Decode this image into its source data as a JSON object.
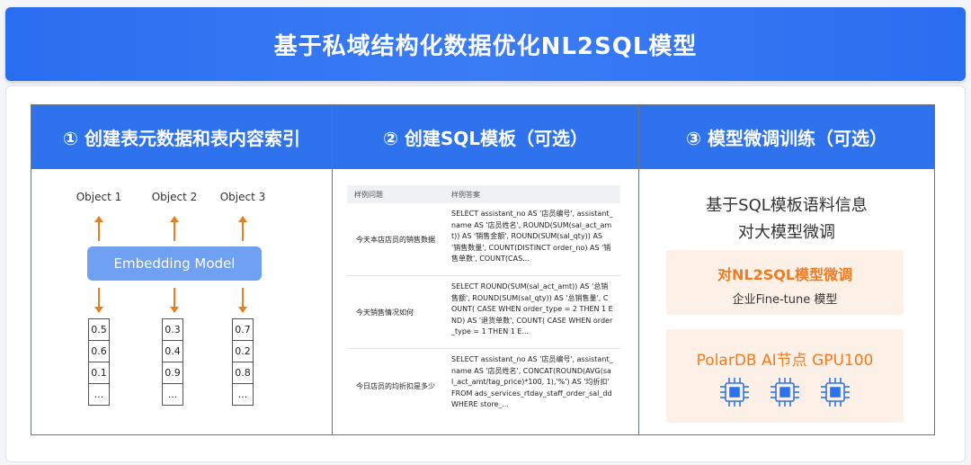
{
  "title": "基于私域结构化数据优化NL2SQL模型",
  "columns": [
    {
      "heading": "① 创建表元数据和表内容索引"
    },
    {
      "heading": "② 创建SQL模板（可选）"
    },
    {
      "heading": "③ 模型微调训练（可选）"
    }
  ],
  "embedding": {
    "objects": [
      "Object 1",
      "Object 2",
      "Object 3"
    ],
    "model_label": "Embedding  Model",
    "vectors": [
      [
        "0.5",
        "0.6",
        "0.1",
        "..."
      ],
      [
        "0.3",
        "0.4",
        "0.9",
        "..."
      ],
      [
        "0.7",
        "0.2",
        "0.8",
        "..."
      ]
    ]
  },
  "sql_table": {
    "header_q": "样例问题",
    "header_a": "样例答案",
    "rows": [
      {
        "q": "今天本店店员的销售数据",
        "a": "SELECT assistant_no AS '店员编号', assistant_name AS '店员姓名', ROUND(SUM(sal_act_amt)) AS '销售金额', ROUND(SUM(sal_qty)) AS '销售数量', COUNT(DISTINCT order_no) AS '销售单数', COUNT(CAS..."
      },
      {
        "q": "今天销售情况如何",
        "a": "SELECT ROUND(SUM(sal_act_amt)) AS '总销售额', ROUND(SUM(sal_qty)) AS '总销售量', COUNT( CASE WHEN order_type = 2 THEN 1 END) AS '退货单数', COUNT( CASE WHEN order_type = 1 THEN 1 E..."
      },
      {
        "q": "今日店员的均折扣是多少",
        "a": "SELECT assistant_no AS '店员编号', assistant_name AS '店员姓名', CONCAT(ROUND(AVG(sal_act_amt/tag_price)*100, 1),'%') AS '均折扣' FROM ads_services_rtday_staff_order_sal_dd WHERE store_..."
      }
    ]
  },
  "finetune": {
    "line1": "基于SQL模板语料信息",
    "line2": "对大模型微调",
    "card1_title": "对NL2SQL模型微调",
    "card1_sub": "企业Fine-tune 模型",
    "card2_title": "PolarDB AI节点 GPU100",
    "chips": [
      "chip-icon",
      "chip-icon",
      "chip-icon"
    ]
  },
  "colors": {
    "title_bg": "#2a6ef0",
    "header_bg": "#2f72ee",
    "embed_bg": "#6fa0f2",
    "arrow": "#e67e22",
    "accent_orange": "#f47a1f",
    "card_bg": "#fdf1e7",
    "chip_blue": "#2f72ee"
  }
}
